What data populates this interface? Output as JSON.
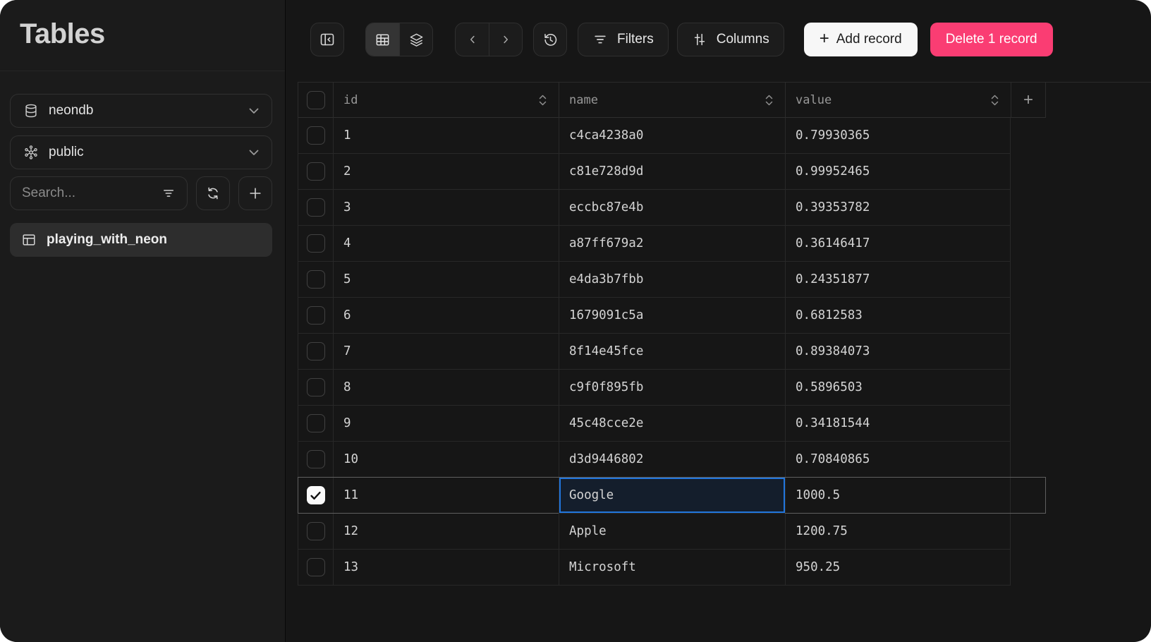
{
  "window_title": "Tables",
  "sidebar": {
    "title": "Tables",
    "database_select": {
      "value": "neondb"
    },
    "schema_select": {
      "value": "public"
    },
    "search": {
      "placeholder": "Search..."
    },
    "tables": [
      {
        "name": "playing_with_neon",
        "selected": true
      }
    ]
  },
  "toolbar": {
    "filters_label": "Filters",
    "columns_label": "Columns",
    "add_record_plus": "+",
    "add_record_label": "Add record",
    "delete_label": "Delete 1 record"
  },
  "grid": {
    "columns": [
      {
        "key": "id",
        "label": "id",
        "sortable": true
      },
      {
        "key": "name",
        "label": "name",
        "sortable": true
      },
      {
        "key": "value",
        "label": "value",
        "sortable": true
      }
    ],
    "add_column_label": "+",
    "selection": {
      "row_id": "11",
      "selected_column": "name",
      "checked_count": 1
    },
    "rows": [
      {
        "id": "1",
        "name": "c4ca4238a0",
        "value": "0.79930365",
        "checked": false
      },
      {
        "id": "2",
        "name": "c81e728d9d",
        "value": "0.99952465",
        "checked": false
      },
      {
        "id": "3",
        "name": "eccbc87e4b",
        "value": "0.39353782",
        "checked": false
      },
      {
        "id": "4",
        "name": "a87ff679a2",
        "value": "0.36146417",
        "checked": false
      },
      {
        "id": "5",
        "name": "e4da3b7fbb",
        "value": "0.24351877",
        "checked": false
      },
      {
        "id": "6",
        "name": "1679091c5a",
        "value": "0.6812583",
        "checked": false
      },
      {
        "id": "7",
        "name": "8f14e45fce",
        "value": "0.89384073",
        "checked": false
      },
      {
        "id": "8",
        "name": "c9f0f895fb",
        "value": "0.5896503",
        "checked": false
      },
      {
        "id": "9",
        "name": "45c48cce2e",
        "value": "0.34181544",
        "checked": false
      },
      {
        "id": "10",
        "name": "d3d9446802",
        "value": "0.70840865",
        "checked": false
      },
      {
        "id": "11",
        "name": "Google",
        "value": "1000.5",
        "checked": true
      },
      {
        "id": "12",
        "name": "Apple",
        "value": "1200.75",
        "checked": false
      },
      {
        "id": "13",
        "name": "Microsoft",
        "value": "950.25",
        "checked": false
      }
    ]
  },
  "icons": {
    "database-icon": "cylinder",
    "schema-icon": "node-graph",
    "filter-icon": "funnel-lines",
    "refresh-icon": "circular-arrows",
    "plus-icon": "plus",
    "table-icon": "small-table",
    "panel-left-icon": "panel-collapse-left",
    "table-grid-icon": "grid",
    "layers-icon": "stacked-layers",
    "chevron-left-icon": "chevron-left",
    "chevron-right-icon": "chevron-right",
    "history-icon": "clock-restore",
    "filter-lines-icon": "funnel-lines",
    "sliders-icon": "vertical-sliders",
    "sort-icon": "up-down-chevrons",
    "chevron-down-icon": "chevron-down",
    "check-icon": "checkmark"
  },
  "colors": {
    "accent_blue": "#2176dd",
    "danger_pink": "#fa3d73",
    "selected_cell_bg": "#141e2c",
    "white_button": "#f7f7f7"
  }
}
